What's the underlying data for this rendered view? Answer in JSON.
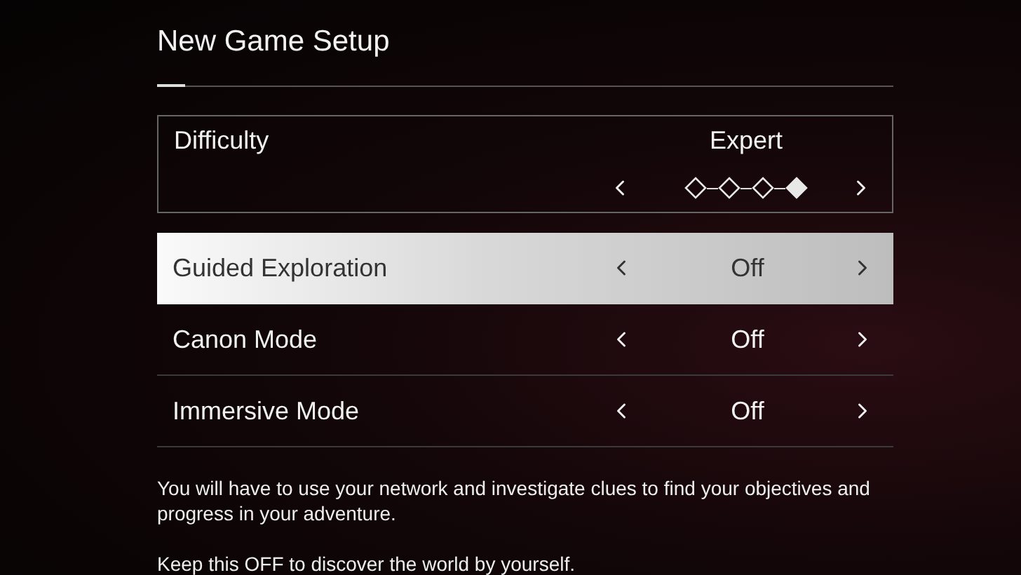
{
  "title": "New Game Setup",
  "difficulty": {
    "label": "Difficulty",
    "value": "Expert",
    "steps": [
      {
        "selected": false
      },
      {
        "selected": false
      },
      {
        "selected": false
      },
      {
        "selected": true
      }
    ]
  },
  "options": [
    {
      "label": "Guided Exploration",
      "value": "Off",
      "selected": true
    },
    {
      "label": "Canon Mode",
      "value": "Off",
      "selected": false
    },
    {
      "label": "Immersive Mode",
      "value": "Off",
      "selected": false
    }
  ],
  "description": [
    "You will have to use your network and investigate clues to find your objectives and progress in your adventure.",
    "Keep this OFF to discover the world by yourself."
  ]
}
